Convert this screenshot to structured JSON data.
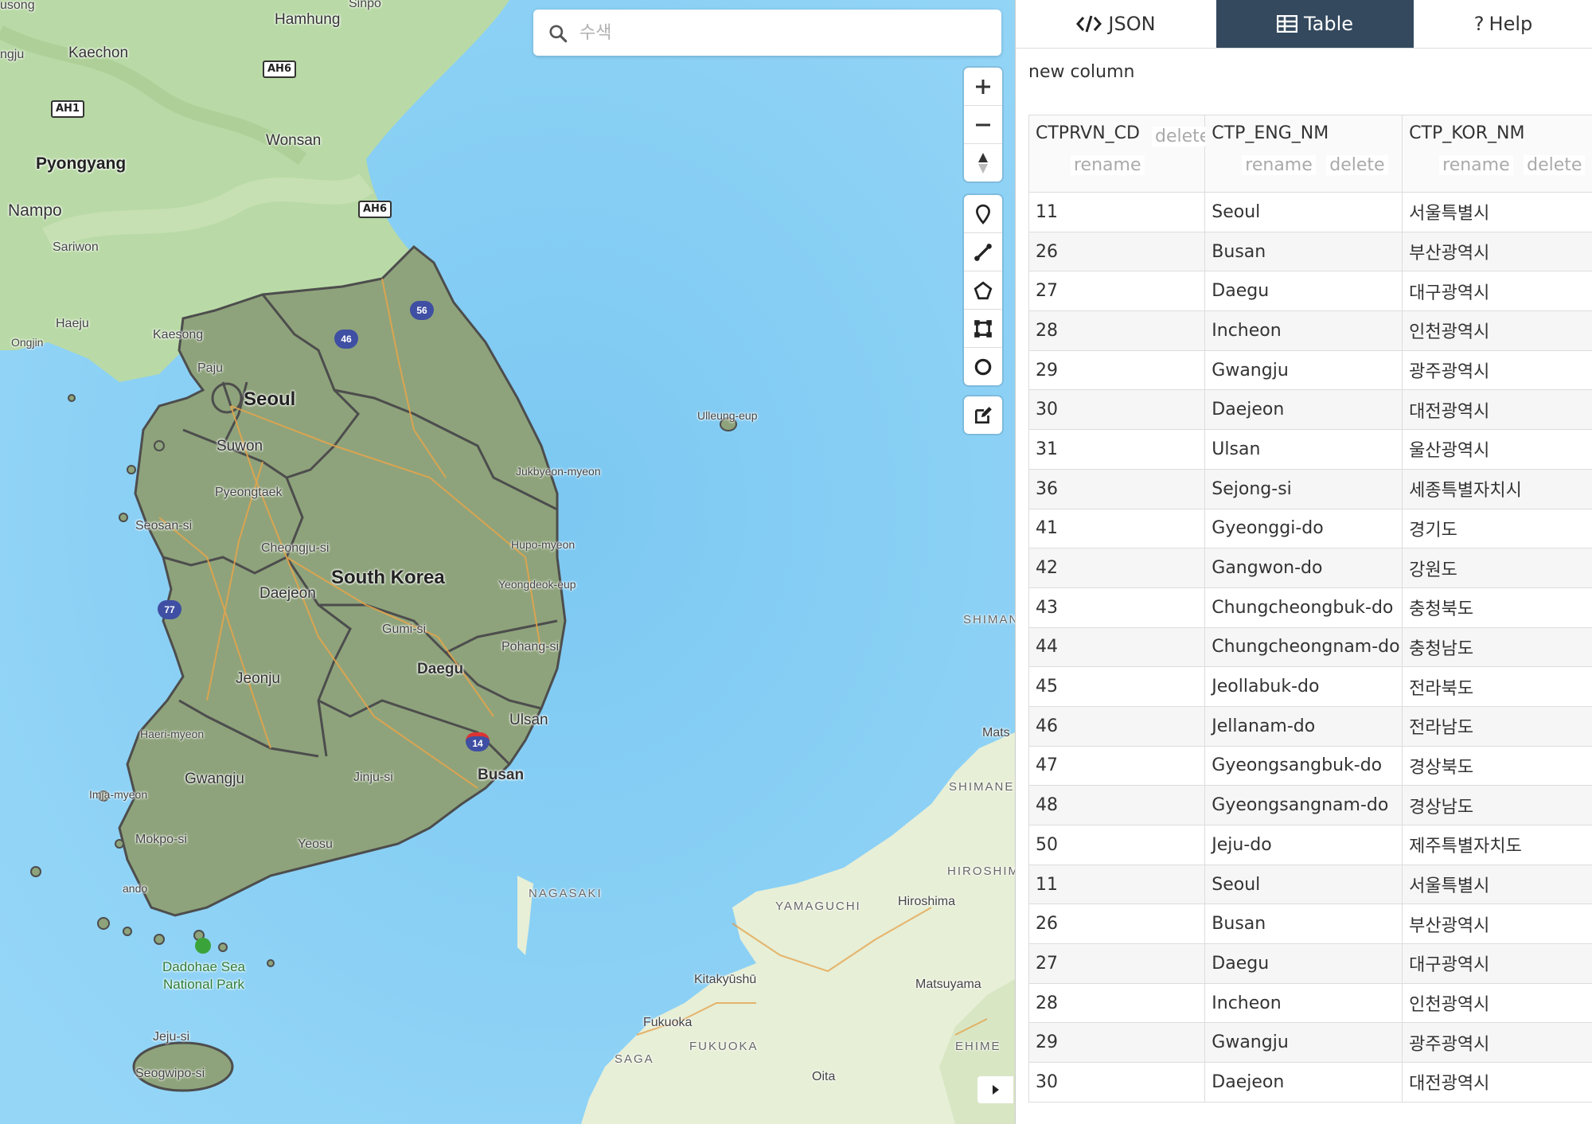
{
  "search": {
    "placeholder": "수색"
  },
  "map": {
    "labels": {
      "hamhung": "Hamhung",
      "kaechon": "Kaechon",
      "pyongyang": "Pyongyang",
      "wonsan": "Wonsan",
      "nampo": "Nampo",
      "sariwon": "Sariwon",
      "haeju": "Haeju",
      "kaesong": "Kaesong",
      "ongjin": "Ongjin",
      "paju": "Paju",
      "seoul": "Seoul",
      "suwon": "Suwon",
      "pyeongtaek": "Pyeongtaek",
      "seosan": "Seosan-si",
      "cheongju": "Cheongju-si",
      "daejeon": "Daejeon",
      "south_korea": "South Korea",
      "gumi": "Gumi-si",
      "daegu": "Daegu",
      "jeonju": "Jeonju",
      "pohang": "Pohang-si",
      "ulsan": "Ulsan",
      "busan": "Busan",
      "jinju": "Jinju-si",
      "gwangju": "Gwangju",
      "mokpo": "Mokpo-si",
      "yeosu": "Yeosu",
      "haeri": "Haeri-myeon",
      "imja": "Imja-myeon",
      "jukbyeon": "Jukbyeon-myeon",
      "hupo": "Hupo-myeon",
      "yeongdeok": "Yeongdeok-eup",
      "ulleung": "Ulleung-eup",
      "dadohae": "Dadohae Sea National Park",
      "jeju": "Jeju-si",
      "seogwipo": "Seogwipo-si",
      "shimane_top": "SHIMAN",
      "mats": "Mats",
      "shimane": "SHIMANE",
      "hiroshima_r": "HIROSHIM",
      "yamaguchi": "YAMAGUCHI",
      "hiroshima": "Hiroshima",
      "nagasaki": "NAGASAKI",
      "kitakyushu": "Kitakyūshū",
      "fukuoka": "Fukuoka",
      "fukuoka_r": "FUKUOKA",
      "matsuyama": "Matsuyama",
      "ehime": "EHIME",
      "saga": "SAGA",
      "oita": "Oita",
      "sinpo": "Sinpo",
      "usong": "usong",
      "ngju": "ngju",
      "ando": "ando"
    },
    "shields": {
      "ah6a": "AH6",
      "ah1": "AH1",
      "ah6b": "AH6"
    },
    "highways": {
      "h56": "56",
      "h46": "46",
      "h77": "77",
      "h14": "14"
    },
    "colors": {
      "sea": "#8cd2f5",
      "land_north": "#b8d9a8",
      "land_south": "#8fa07c",
      "japan": "#e9f0d9",
      "boundary": "#555555"
    }
  },
  "panel": {
    "tabs": [
      {
        "label": "JSON",
        "icon": "code-icon"
      },
      {
        "label": "Table",
        "icon": "table-icon"
      },
      {
        "label": "Help",
        "icon": "question-icon"
      }
    ],
    "active_tab": "Table",
    "new_column": "new column",
    "columns": [
      {
        "name": "CTPRVN_CD",
        "rename": "rename",
        "delete": "delete"
      },
      {
        "name": "CTP_ENG_NM",
        "rename": "rename",
        "delete": "delete"
      },
      {
        "name": "CTP_KOR_NM",
        "rename": "rename",
        "delete": "delete"
      }
    ],
    "rows": [
      [
        "11",
        "Seoul",
        "서울특별시"
      ],
      [
        "26",
        "Busan",
        "부산광역시"
      ],
      [
        "27",
        "Daegu",
        "대구광역시"
      ],
      [
        "28",
        "Incheon",
        "인천광역시"
      ],
      [
        "29",
        "Gwangju",
        "광주광역시"
      ],
      [
        "30",
        "Daejeon",
        "대전광역시"
      ],
      [
        "31",
        "Ulsan",
        "울산광역시"
      ],
      [
        "36",
        "Sejong-si",
        "세종특별자치시"
      ],
      [
        "41",
        "Gyeonggi-do",
        "경기도"
      ],
      [
        "42",
        "Gangwon-do",
        "강원도"
      ],
      [
        "43",
        "Chungcheongbuk-do",
        "충청북도"
      ],
      [
        "44",
        "Chungcheongnam-do",
        "충청남도"
      ],
      [
        "45",
        "Jeollabuk-do",
        "전라북도"
      ],
      [
        "46",
        "Jellanam-do",
        "전라남도"
      ],
      [
        "47",
        "Gyeongsangbuk-do",
        "경상북도"
      ],
      [
        "48",
        "Gyeongsangnam-do",
        "경상남도"
      ],
      [
        "50",
        "Jeju-do",
        "제주특별자치도"
      ],
      [
        "11",
        "Seoul",
        "서울특별시"
      ],
      [
        "26",
        "Busan",
        "부산광역시"
      ],
      [
        "27",
        "Daegu",
        "대구광역시"
      ],
      [
        "28",
        "Incheon",
        "인천광역시"
      ],
      [
        "29",
        "Gwangju",
        "광주광역시"
      ],
      [
        "30",
        "Daejeon",
        "대전광역시"
      ]
    ]
  }
}
